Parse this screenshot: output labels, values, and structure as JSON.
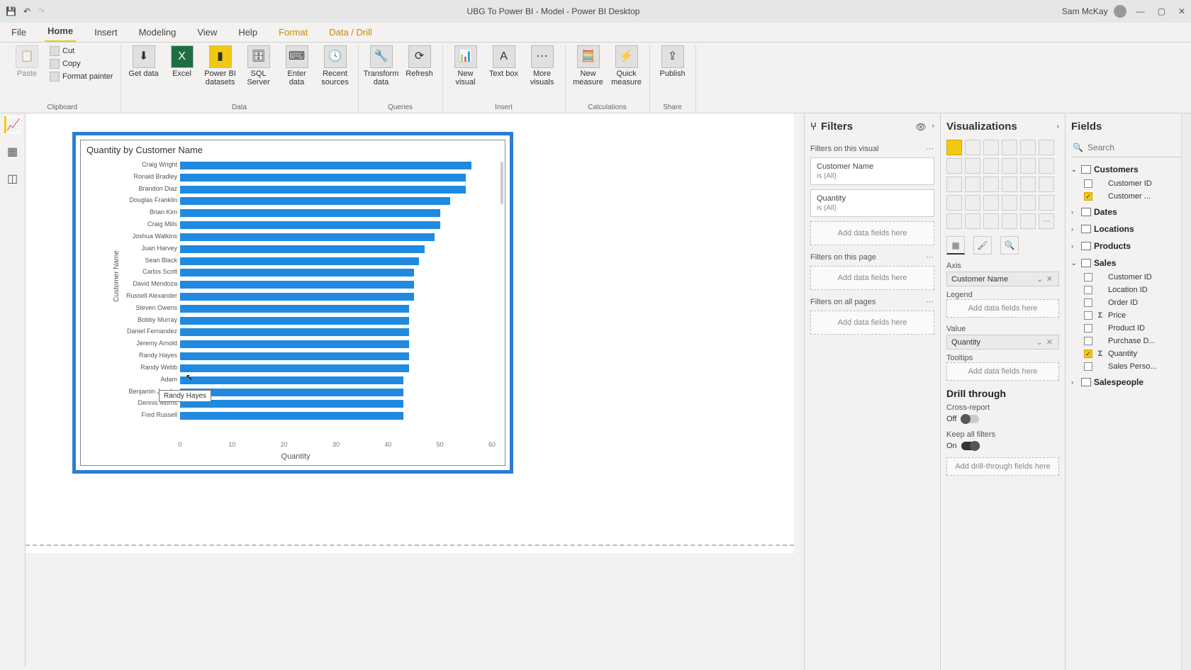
{
  "titlebar": {
    "title": "UBG To Power BI - Model - Power BI Desktop",
    "user": "Sam McKay"
  },
  "tabs": [
    "File",
    "Home",
    "Insert",
    "Modeling",
    "View",
    "Help",
    "Format",
    "Data / Drill"
  ],
  "active_tab": "Home",
  "ribbon": {
    "clipboard": {
      "cut": "Cut",
      "copy": "Copy",
      "format_painter": "Format painter",
      "paste": "Paste",
      "label": "Clipboard"
    },
    "data": {
      "get": "Get data",
      "excel": "Excel",
      "pbids": "Power BI datasets",
      "sql": "SQL Server",
      "enter": "Enter data",
      "recent": "Recent sources",
      "label": "Data"
    },
    "queries": {
      "transform": "Transform data",
      "refresh": "Refresh",
      "label": "Queries"
    },
    "insert": {
      "newvisual": "New visual",
      "textbox": "Text box",
      "more": "More visuals",
      "label": "Insert"
    },
    "calc": {
      "newmeasure": "New measure",
      "quickmeasure": "Quick measure",
      "label": "Calculations"
    },
    "share": {
      "publish": "Publish",
      "label": "Share"
    }
  },
  "chart_data": {
    "type": "bar",
    "orientation": "horizontal",
    "title": "Quantity by Customer Name",
    "xlabel": "Quantity",
    "ylabel": "Customer Name",
    "xlim": [
      0,
      60
    ],
    "x_ticks": [
      0,
      10,
      20,
      30,
      40,
      50,
      60
    ],
    "categories": [
      "Craig Wright",
      "Ronald Bradley",
      "Brandon Diaz",
      "Douglas Franklin",
      "Brian Kim",
      "Craig Mills",
      "Joshua Watkins",
      "Juan Harvey",
      "Sean Black",
      "Carlos Scott",
      "David Mendoza",
      "Russell Alexander",
      "Steven Owens",
      "Bobby Murray",
      "Daniel Fernandez",
      "Jeremy Arnold",
      "Randy Hayes",
      "Randy Webb",
      "Adam",
      "Benjamin Jacobs",
      "Dennis Morris",
      "Fred Russell"
    ],
    "values": [
      56,
      55,
      55,
      52,
      50,
      50,
      49,
      47,
      46,
      45,
      45,
      45,
      44,
      44,
      44,
      44,
      44,
      44,
      43,
      43,
      43,
      43
    ],
    "tooltip": {
      "label": "Randy Hayes",
      "row_index": 16
    }
  },
  "filters_panel": {
    "title": "Filters",
    "on_visual_label": "Filters on this visual",
    "cards": [
      {
        "name": "Customer Name",
        "state": "is (All)"
      },
      {
        "name": "Quantity",
        "state": "is (All)"
      }
    ],
    "add_here": "Add data fields here",
    "on_page_label": "Filters on this page",
    "on_all_label": "Filters on all pages"
  },
  "viz_panel": {
    "title": "Visualizations",
    "axis": "Axis",
    "axis_field": "Customer Name",
    "legend": "Legend",
    "value": "Value",
    "value_field": "Quantity",
    "tooltips": "Tooltips",
    "add_here": "Add data fields here",
    "drill": "Drill through",
    "cross": "Cross-report",
    "off": "Off",
    "keep": "Keep all filters",
    "on": "On",
    "drill_add": "Add drill-through fields here"
  },
  "fields_panel": {
    "title": "Fields",
    "search_placeholder": "Search",
    "tables": [
      {
        "name": "Customers",
        "expanded": true,
        "fields": [
          {
            "name": "Customer ID",
            "sigma": false,
            "checked": false
          },
          {
            "name": "Customer ...",
            "sigma": false,
            "checked": true
          }
        ]
      },
      {
        "name": "Dates",
        "expanded": false,
        "fields": []
      },
      {
        "name": "Locations",
        "expanded": false,
        "fields": []
      },
      {
        "name": "Products",
        "expanded": false,
        "fields": []
      },
      {
        "name": "Sales",
        "expanded": true,
        "fields": [
          {
            "name": "Customer ID",
            "sigma": false,
            "checked": false
          },
          {
            "name": "Location ID",
            "sigma": false,
            "checked": false
          },
          {
            "name": "Order ID",
            "sigma": false,
            "checked": false
          },
          {
            "name": "Price",
            "sigma": true,
            "checked": false
          },
          {
            "name": "Product ID",
            "sigma": false,
            "checked": false
          },
          {
            "name": "Purchase D...",
            "sigma": false,
            "checked": false
          },
          {
            "name": "Quantity",
            "sigma": true,
            "checked": true
          },
          {
            "name": "Sales Perso...",
            "sigma": false,
            "checked": false
          }
        ]
      },
      {
        "name": "Salespeople",
        "expanded": false,
        "fields": []
      }
    ]
  }
}
